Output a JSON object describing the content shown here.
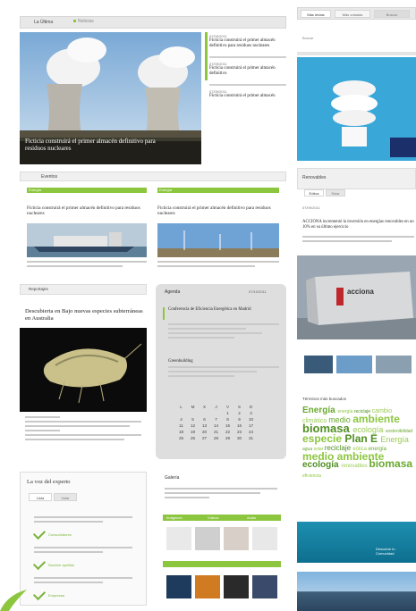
{
  "header": {
    "tab_active": "La Última",
    "tab_inactive": "Noticias"
  },
  "hero": {
    "caption": "Ficticia construirá el primer almacén definitivo para residuos nucleares"
  },
  "news_list": [
    {
      "date": "07/09/2011",
      "title": "Ficticia construirá el primer almacén definitivo para residuos nucleares"
    },
    {
      "date": "07/09/2011",
      "title": "Ficticia construirá el primer almacén definitivo"
    },
    {
      "date": "07/09/2011",
      "title": "Ficticia construirá el primer almacén"
    }
  ],
  "articles_heading": "Eventos",
  "cards": [
    {
      "category": "Energía",
      "title": "Ficticia construirá el primer almacén definitivo para residuos nucleares"
    },
    {
      "category": "Energía",
      "title": "Ficticia construirá el primer almacén definitivo para residuos nucleares"
    }
  ],
  "featured": {
    "section": "Reportajes",
    "title": "Descubierta en Bajo nuevas especies subterráneas en Australia"
  },
  "voice": {
    "title": "La voz del experto",
    "tabs": [
      "Lista",
      "Votar"
    ],
    "items": [
      "Consumidores",
      "Nombre apellido",
      "Empresas"
    ]
  },
  "agenda": {
    "title": "Agenda",
    "date": "07/10/2011",
    "event_title": "Conferencia de Eficiencia Energética en Madrid",
    "subtitle": "Greenbuilding",
    "calendar_head": [
      "L",
      "M",
      "X",
      "J",
      "V",
      "S",
      "D"
    ],
    "calendar_rows": [
      [
        "",
        "",
        "",
        "",
        "1",
        "2",
        "3"
      ],
      [
        "4",
        "5",
        "6",
        "7",
        "8",
        "9",
        "10"
      ],
      [
        "11",
        "12",
        "13",
        "14",
        "15",
        "16",
        "17"
      ],
      [
        "18",
        "19",
        "20",
        "21",
        "22",
        "23",
        "24"
      ],
      [
        "25",
        "26",
        "27",
        "28",
        "29",
        "30",
        "31"
      ]
    ]
  },
  "galeria": {
    "title": "Galería",
    "buttons": [
      "Imágenes",
      "Vídeos",
      "Audio"
    ]
  },
  "sidebar": {
    "tabs": [
      "Más leídas",
      "Más votadas",
      "Buscar"
    ],
    "search_placeholder": "Buscar",
    "section": "Renovables",
    "news_tabs": [
      "Eólica",
      "Solar"
    ],
    "news_date": "07/09/2011",
    "news_title": "ACCIONA incrementó la inversión en energías renovables en un 10% en su último ejercicio",
    "brand": "acciona",
    "tags_title": "Términos más buscados",
    "tags": [
      {
        "t": "Energía",
        "s": 10
      },
      {
        "t": "energía",
        "s": 5
      },
      {
        "t": "reciclaje",
        "s": 5
      },
      {
        "t": "cambio climático",
        "s": 7
      },
      {
        "t": "medio",
        "s": 9
      },
      {
        "t": "ambiente",
        "s": 12
      },
      {
        "t": "biomasa",
        "s": 13
      },
      {
        "t": "ecología",
        "s": 9
      },
      {
        "t": "sostenibilidad",
        "s": 5
      },
      {
        "t": "especie",
        "s": 12
      },
      {
        "t": "Plan E",
        "s": 12
      },
      {
        "t": "Energía",
        "s": 9
      },
      {
        "t": "agua",
        "s": 5
      },
      {
        "t": "solar",
        "s": 5
      },
      {
        "t": "reciclaje",
        "s": 8
      },
      {
        "t": "eólica",
        "s": 6
      },
      {
        "t": "energía",
        "s": 6
      },
      {
        "t": "medio ambiente",
        "s": 12
      },
      {
        "t": "ecología",
        "s": 10
      },
      {
        "t": "renovables",
        "s": 6
      },
      {
        "t": "biomasa",
        "s": 12
      },
      {
        "t": "eficiencia",
        "s": 5
      }
    ],
    "banner_text": "Descubre tu Comunidad"
  },
  "colors": {
    "accent": "#8cc63f",
    "panel": "#ececec"
  }
}
